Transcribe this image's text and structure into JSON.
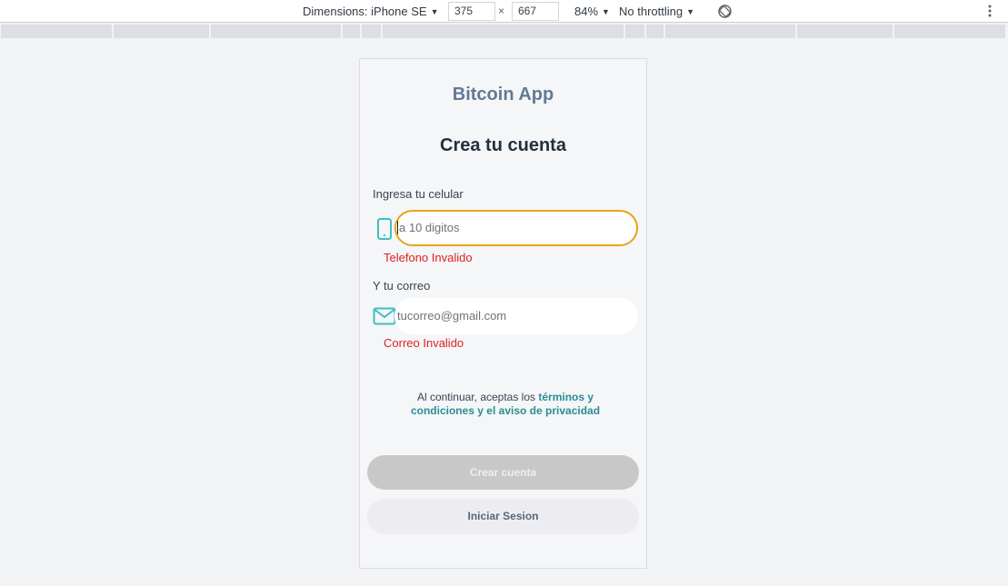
{
  "devtools": {
    "dimensions_label": "Dimensions: iPhone SE",
    "width": "375",
    "height": "667",
    "times": "×",
    "zoom": "84%",
    "throttling": "No throttling",
    "caret": "▼"
  },
  "app": {
    "title": "Bitcoin App",
    "heading": "Crea tu cuenta",
    "phone": {
      "label": "Ingresa tu celular",
      "placeholder": "a 10 digitos",
      "error": "Telefono Invalido"
    },
    "email": {
      "label": "Y tu correo",
      "placeholder": "tucorreo@gmail.com",
      "error": "Correo Invalido"
    },
    "terms": {
      "prefix": "Al continuar, aceptas los",
      "link": "términos y condiciones y el aviso de privacidad"
    },
    "buttons": {
      "create": "Crear cuenta",
      "login": "Iniciar Sesion"
    }
  },
  "colors": {
    "accent": "#2c8c95",
    "icon": "#3fbfbf",
    "error": "#e02121",
    "focus_border": "#e8a317",
    "disabled_button": "#c8c8c8"
  }
}
